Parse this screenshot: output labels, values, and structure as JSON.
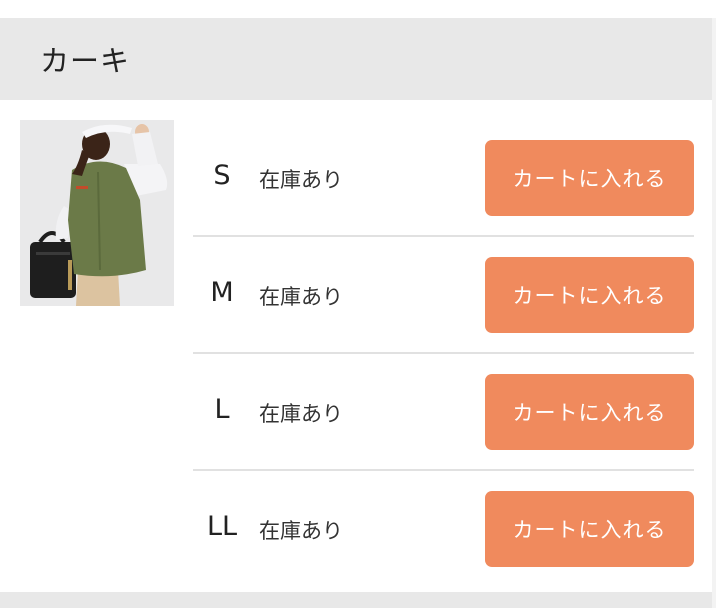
{
  "product_color": {
    "name": "カーキ"
  },
  "sizes": [
    {
      "size": "S",
      "stock": "在庫あり",
      "button": "カートに入れる"
    },
    {
      "size": "M",
      "stock": "在庫あり",
      "button": "カートに入れる"
    },
    {
      "size": "L",
      "stock": "在庫あり",
      "button": "カートに入れる"
    },
    {
      "size": "LL",
      "stock": "在庫あり",
      "button": "カートに入れる"
    }
  ],
  "colors": {
    "header_bg": "#e8e8e8",
    "button_bg": "#f08a5d",
    "button_text": "#ffffff",
    "divider": "#e1e1e1"
  }
}
